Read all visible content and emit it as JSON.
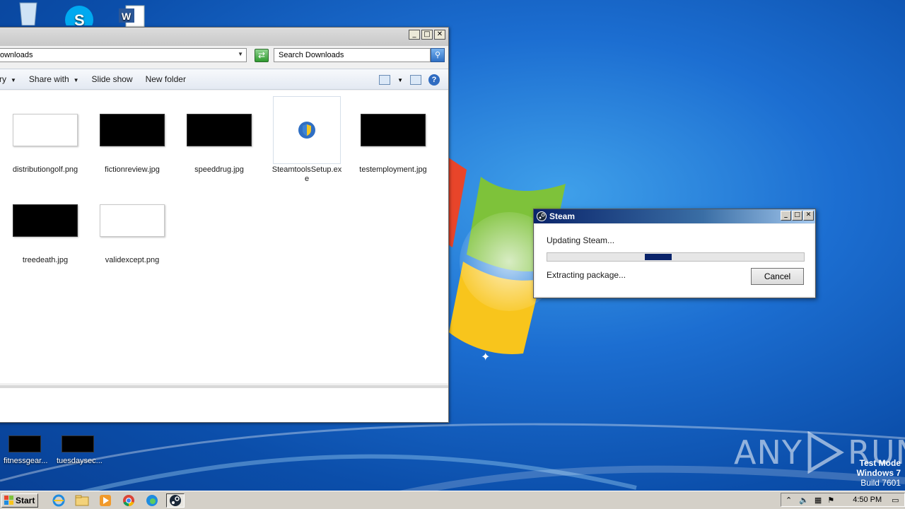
{
  "desktop": {
    "icons_top": [
      "recycle-bin-icon",
      "skype-icon",
      "word-icon"
    ],
    "icons_bottom": [
      {
        "label": "fitnessgear...",
        "icon": "image-thumbnail-icon"
      },
      {
        "label": "tuesdaysec...",
        "icon": "image-thumbnail-icon"
      }
    ],
    "watermark": {
      "left": "ANY",
      "right": "RUN"
    },
    "test_mode": {
      "line1": "Test Mode",
      "line2": "Windows 7",
      "line3": "Build 7601"
    }
  },
  "explorer": {
    "address": "ownloads",
    "search_placeholder": "Search Downloads",
    "toolbar": {
      "organize_partial": "ry",
      "share_with": "Share with",
      "slide_show": "Slide show",
      "new_folder": "New folder"
    },
    "caption": {
      "minimize": "_",
      "maximize": "□",
      "close": "✕"
    },
    "files": [
      {
        "name": "distributiongolf.png",
        "thumb": "white"
      },
      {
        "name": "fictionreview.jpg",
        "thumb": "black"
      },
      {
        "name": "speeddrug.jpg",
        "thumb": "black"
      },
      {
        "name": "SteamtoolsSetup.exe",
        "thumb": "exe"
      },
      {
        "name": "testemployment.jpg",
        "thumb": "black"
      },
      {
        "name": "treedeath.jpg",
        "thumb": "black"
      },
      {
        "name": "validexcept.png",
        "thumb": "white"
      }
    ]
  },
  "steam_dialog": {
    "title": "Steam",
    "status": "Updating Steam...",
    "substatus": "Extracting package...",
    "cancel": "Cancel",
    "progress": {
      "indeterminate": true,
      "segment_start": 0.38,
      "segment_end": 0.485
    },
    "accent": "#0a246a"
  },
  "taskbar": {
    "start": "Start",
    "quick_icons": [
      "internet-explorer-icon",
      "explorer-icon",
      "media-player-icon",
      "chrome-icon",
      "edge-icon",
      "steam-icon"
    ],
    "active_icon": "steam-icon",
    "clock": "4:50 PM"
  }
}
